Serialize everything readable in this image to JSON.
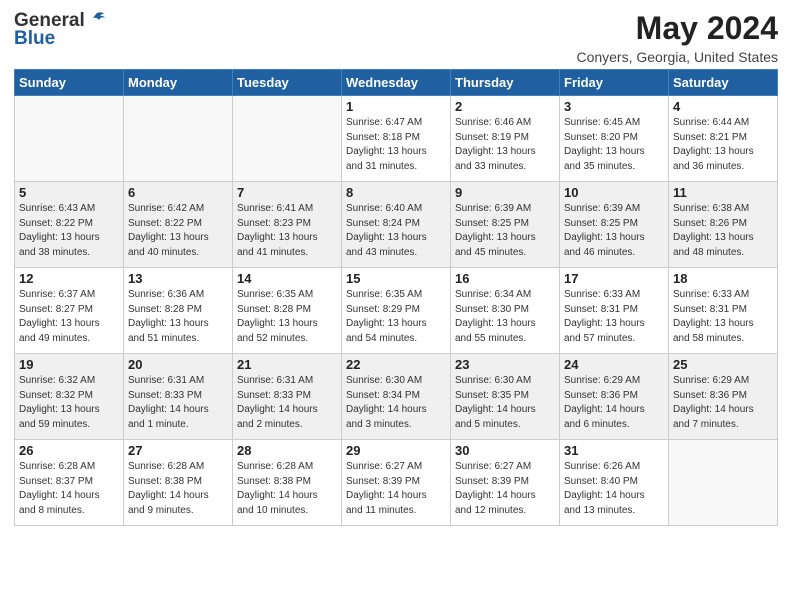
{
  "header": {
    "logo_general": "General",
    "logo_blue": "Blue",
    "month_title": "May 2024",
    "location": "Conyers, Georgia, United States"
  },
  "weekdays": [
    "Sunday",
    "Monday",
    "Tuesday",
    "Wednesday",
    "Thursday",
    "Friday",
    "Saturday"
  ],
  "weeks": [
    [
      {
        "day": "",
        "info": ""
      },
      {
        "day": "",
        "info": ""
      },
      {
        "day": "",
        "info": ""
      },
      {
        "day": "1",
        "info": "Sunrise: 6:47 AM\nSunset: 8:18 PM\nDaylight: 13 hours\nand 31 minutes."
      },
      {
        "day": "2",
        "info": "Sunrise: 6:46 AM\nSunset: 8:19 PM\nDaylight: 13 hours\nand 33 minutes."
      },
      {
        "day": "3",
        "info": "Sunrise: 6:45 AM\nSunset: 8:20 PM\nDaylight: 13 hours\nand 35 minutes."
      },
      {
        "day": "4",
        "info": "Sunrise: 6:44 AM\nSunset: 8:21 PM\nDaylight: 13 hours\nand 36 minutes."
      }
    ],
    [
      {
        "day": "5",
        "info": "Sunrise: 6:43 AM\nSunset: 8:22 PM\nDaylight: 13 hours\nand 38 minutes."
      },
      {
        "day": "6",
        "info": "Sunrise: 6:42 AM\nSunset: 8:22 PM\nDaylight: 13 hours\nand 40 minutes."
      },
      {
        "day": "7",
        "info": "Sunrise: 6:41 AM\nSunset: 8:23 PM\nDaylight: 13 hours\nand 41 minutes."
      },
      {
        "day": "8",
        "info": "Sunrise: 6:40 AM\nSunset: 8:24 PM\nDaylight: 13 hours\nand 43 minutes."
      },
      {
        "day": "9",
        "info": "Sunrise: 6:39 AM\nSunset: 8:25 PM\nDaylight: 13 hours\nand 45 minutes."
      },
      {
        "day": "10",
        "info": "Sunrise: 6:39 AM\nSunset: 8:25 PM\nDaylight: 13 hours\nand 46 minutes."
      },
      {
        "day": "11",
        "info": "Sunrise: 6:38 AM\nSunset: 8:26 PM\nDaylight: 13 hours\nand 48 minutes."
      }
    ],
    [
      {
        "day": "12",
        "info": "Sunrise: 6:37 AM\nSunset: 8:27 PM\nDaylight: 13 hours\nand 49 minutes."
      },
      {
        "day": "13",
        "info": "Sunrise: 6:36 AM\nSunset: 8:28 PM\nDaylight: 13 hours\nand 51 minutes."
      },
      {
        "day": "14",
        "info": "Sunrise: 6:35 AM\nSunset: 8:28 PM\nDaylight: 13 hours\nand 52 minutes."
      },
      {
        "day": "15",
        "info": "Sunrise: 6:35 AM\nSunset: 8:29 PM\nDaylight: 13 hours\nand 54 minutes."
      },
      {
        "day": "16",
        "info": "Sunrise: 6:34 AM\nSunset: 8:30 PM\nDaylight: 13 hours\nand 55 minutes."
      },
      {
        "day": "17",
        "info": "Sunrise: 6:33 AM\nSunset: 8:31 PM\nDaylight: 13 hours\nand 57 minutes."
      },
      {
        "day": "18",
        "info": "Sunrise: 6:33 AM\nSunset: 8:31 PM\nDaylight: 13 hours\nand 58 minutes."
      }
    ],
    [
      {
        "day": "19",
        "info": "Sunrise: 6:32 AM\nSunset: 8:32 PM\nDaylight: 13 hours\nand 59 minutes."
      },
      {
        "day": "20",
        "info": "Sunrise: 6:31 AM\nSunset: 8:33 PM\nDaylight: 14 hours\nand 1 minute."
      },
      {
        "day": "21",
        "info": "Sunrise: 6:31 AM\nSunset: 8:33 PM\nDaylight: 14 hours\nand 2 minutes."
      },
      {
        "day": "22",
        "info": "Sunrise: 6:30 AM\nSunset: 8:34 PM\nDaylight: 14 hours\nand 3 minutes."
      },
      {
        "day": "23",
        "info": "Sunrise: 6:30 AM\nSunset: 8:35 PM\nDaylight: 14 hours\nand 5 minutes."
      },
      {
        "day": "24",
        "info": "Sunrise: 6:29 AM\nSunset: 8:36 PM\nDaylight: 14 hours\nand 6 minutes."
      },
      {
        "day": "25",
        "info": "Sunrise: 6:29 AM\nSunset: 8:36 PM\nDaylight: 14 hours\nand 7 minutes."
      }
    ],
    [
      {
        "day": "26",
        "info": "Sunrise: 6:28 AM\nSunset: 8:37 PM\nDaylight: 14 hours\nand 8 minutes."
      },
      {
        "day": "27",
        "info": "Sunrise: 6:28 AM\nSunset: 8:38 PM\nDaylight: 14 hours\nand 9 minutes."
      },
      {
        "day": "28",
        "info": "Sunrise: 6:28 AM\nSunset: 8:38 PM\nDaylight: 14 hours\nand 10 minutes."
      },
      {
        "day": "29",
        "info": "Sunrise: 6:27 AM\nSunset: 8:39 PM\nDaylight: 14 hours\nand 11 minutes."
      },
      {
        "day": "30",
        "info": "Sunrise: 6:27 AM\nSunset: 8:39 PM\nDaylight: 14 hours\nand 12 minutes."
      },
      {
        "day": "31",
        "info": "Sunrise: 6:26 AM\nSunset: 8:40 PM\nDaylight: 14 hours\nand 13 minutes."
      },
      {
        "day": "",
        "info": ""
      }
    ]
  ]
}
